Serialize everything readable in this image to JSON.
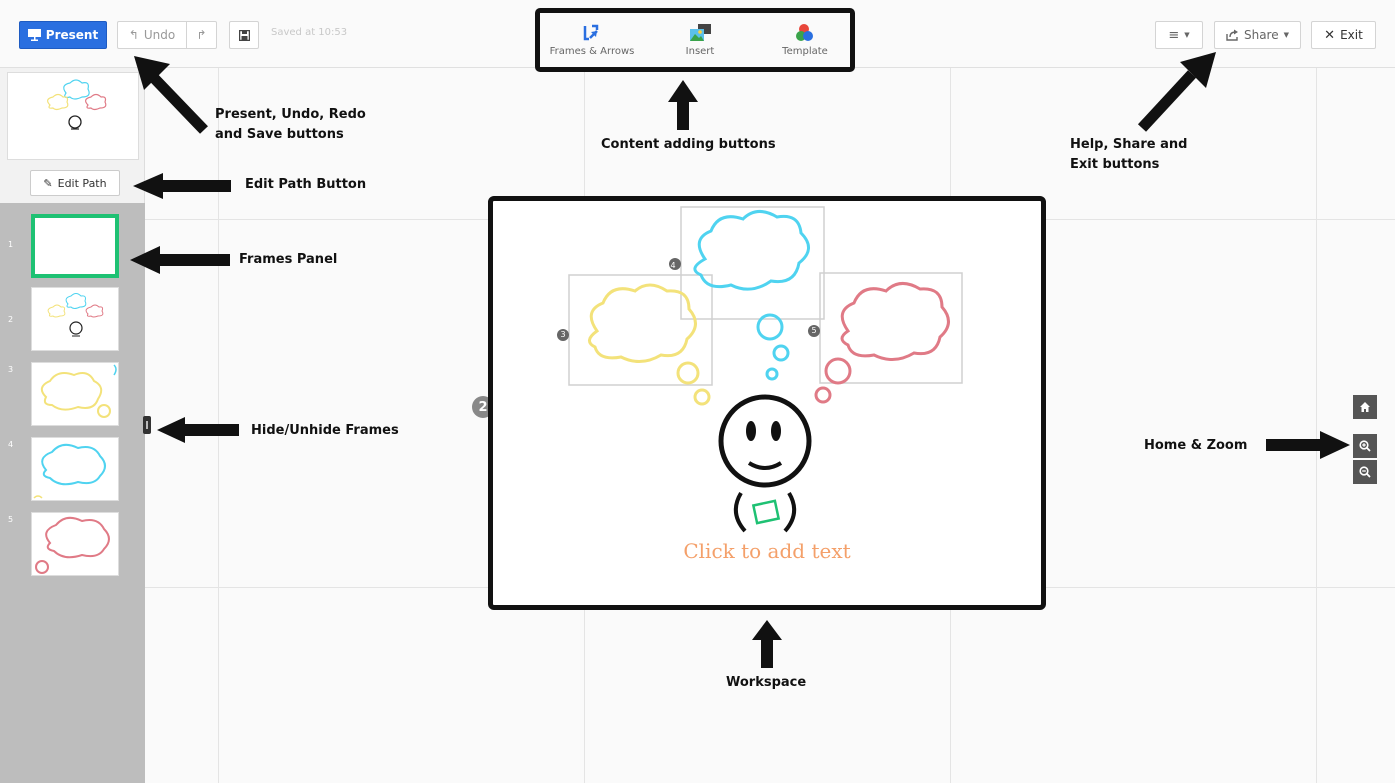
{
  "toolbar": {
    "present_label": "Present",
    "undo_label": "Undo",
    "saved_text": "Saved at 10:53",
    "content_buttons": [
      {
        "label": "Frames & Arrows",
        "icon": "frames-arrows-icon"
      },
      {
        "label": "Insert",
        "icon": "insert-image-icon"
      },
      {
        "label": "Template",
        "icon": "template-icon"
      }
    ],
    "menu_icon": "hamburger-icon",
    "share_label": "Share",
    "exit_label": "Exit"
  },
  "sidebar": {
    "edit_path_label": "Edit Path",
    "frames": [
      {
        "number": "1"
      },
      {
        "number": "2"
      },
      {
        "number": "3"
      },
      {
        "number": "4"
      },
      {
        "number": "5"
      }
    ]
  },
  "workspace": {
    "path_number": "2",
    "click_to_add_text": "Click to add text",
    "bubble_numbers": [
      "4",
      "3",
      "5"
    ]
  },
  "annotations": {
    "present_undo_redo_save": [
      "Present, Undo, Redo",
      "and Save buttons"
    ],
    "edit_path_button": "Edit Path Button",
    "frames_panel": "Frames Panel",
    "hide_unhide_frames": "Hide/Unhide Frames",
    "content_adding_buttons": "Content adding buttons",
    "help_share_exit": [
      "Help, Share and",
      "Exit buttons"
    ],
    "home_zoom": "Home & Zoom",
    "workspace": "Workspace"
  },
  "colors": {
    "present_blue": "#2a6fe0",
    "frame_selected_green": "#1ec173",
    "bubble_cyan": "#4fd3f0",
    "bubble_yellow": "#f3e27a",
    "bubble_red": "#e07a86",
    "click_text_orange": "#f4a06a"
  }
}
